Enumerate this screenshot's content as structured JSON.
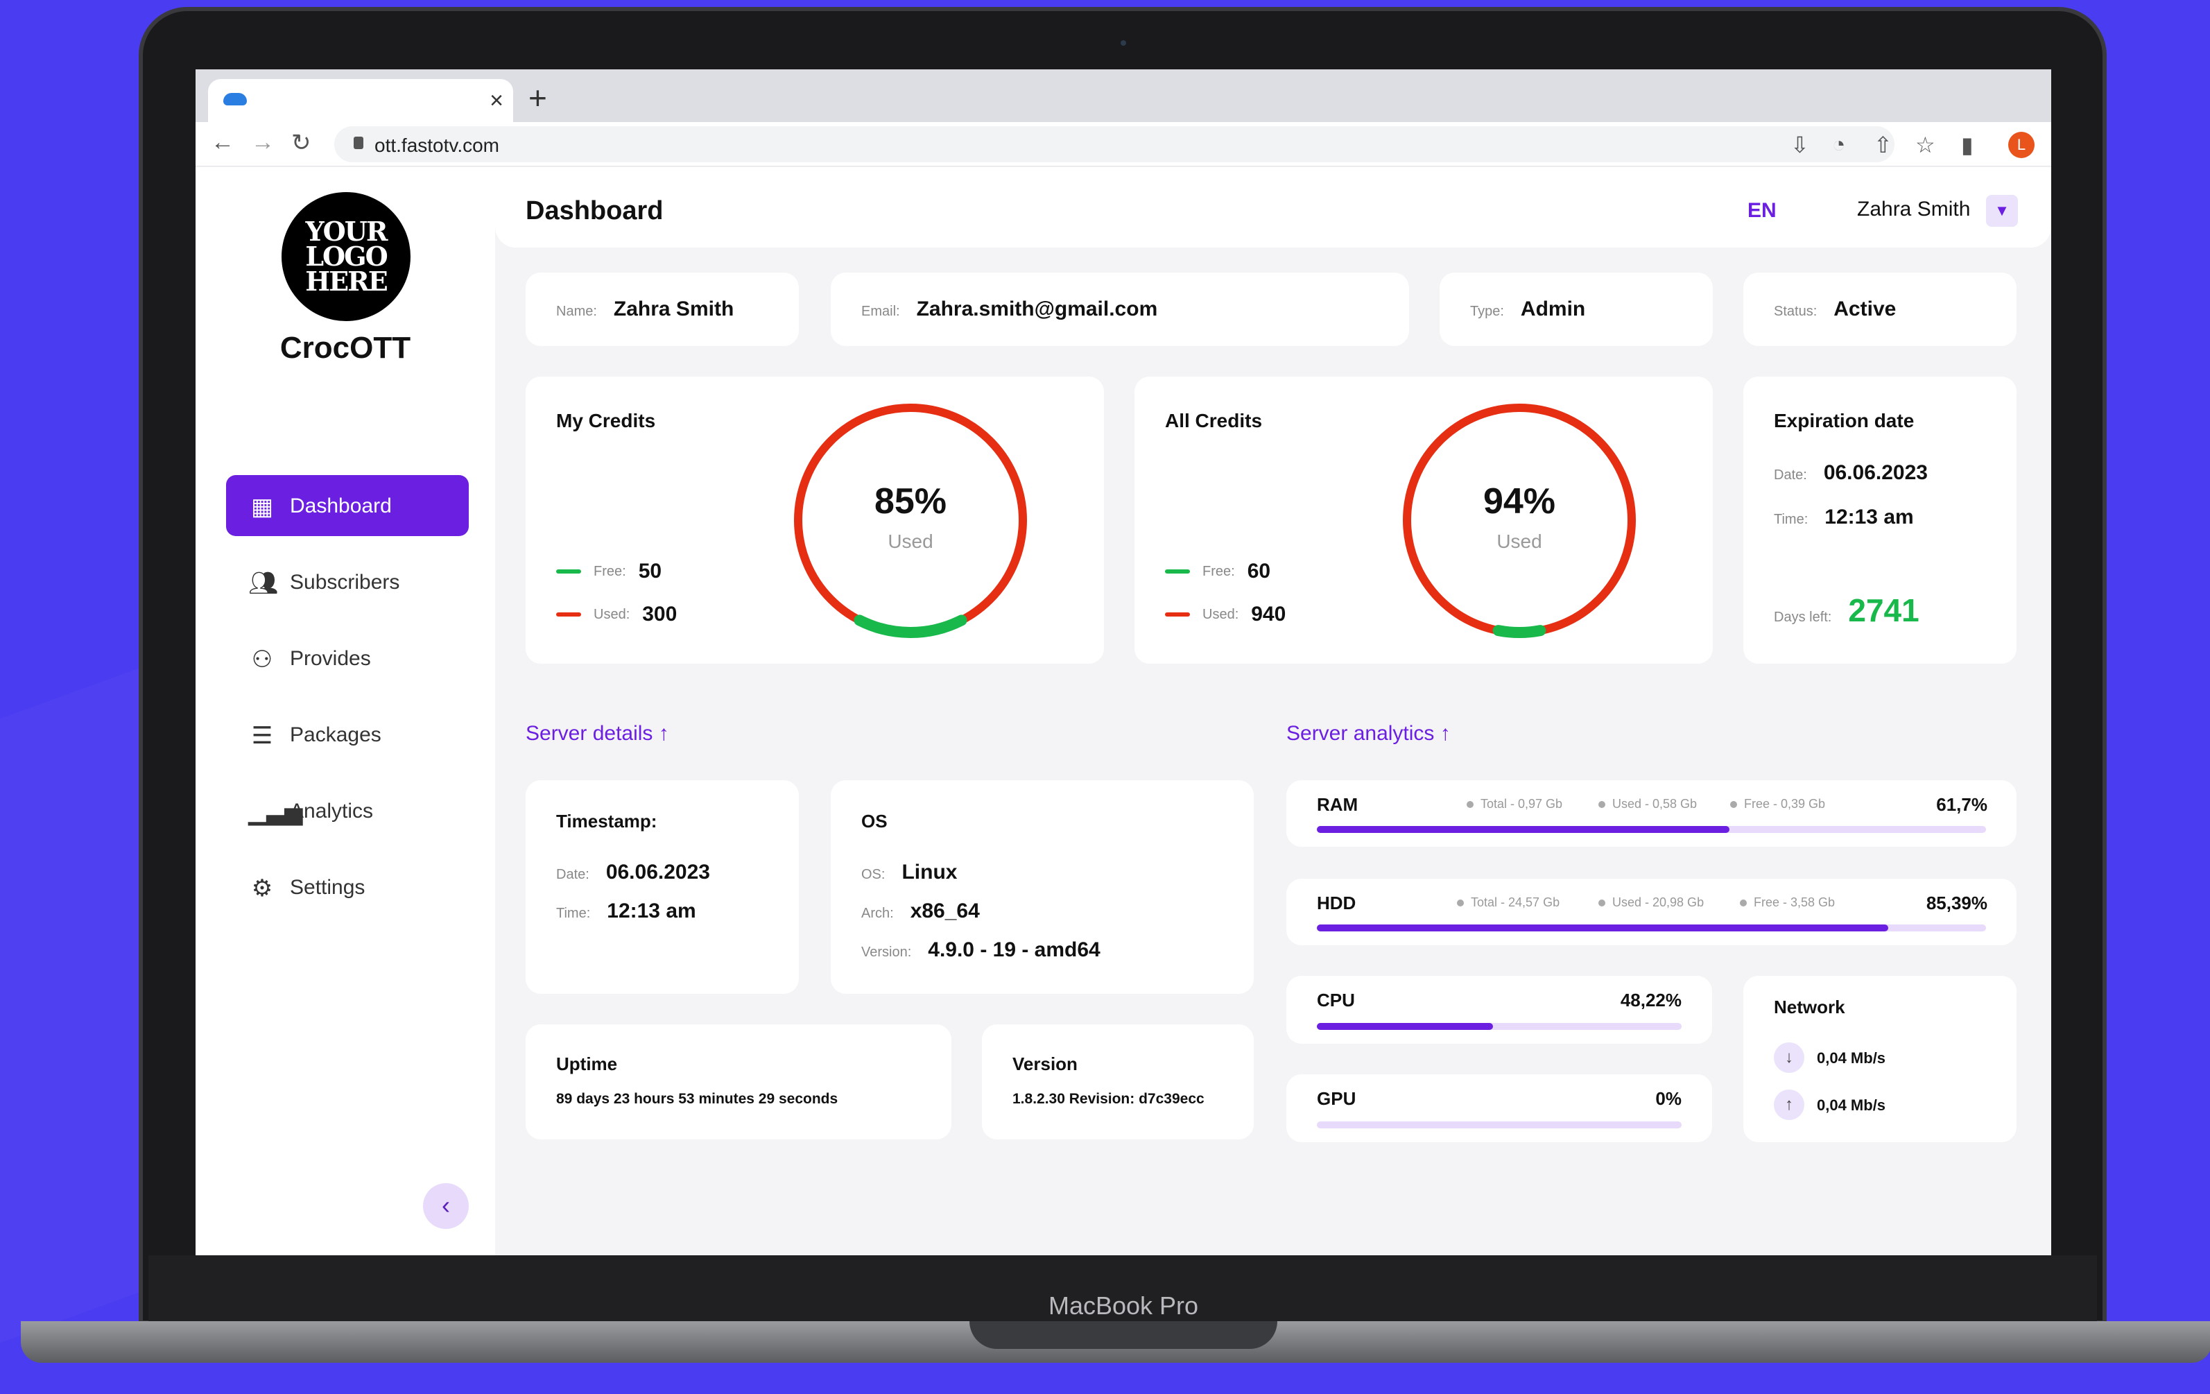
{
  "colors": {
    "accent": "#6b1fe0",
    "free": "#18b84a",
    "used": "#e62e12",
    "days_left": "#18b84a"
  },
  "device": {
    "label": "MacBook Pro"
  },
  "browser": {
    "url": "ott.fastotv.com",
    "new_tab": "+",
    "close_tab": "×",
    "avatar_initial": "L"
  },
  "sidebar": {
    "logo_text": "YOUR LOGO HERE",
    "app_name": "CrocOTT",
    "items": [
      {
        "label": "Dashboard",
        "icon": "grid-icon"
      },
      {
        "label": "Subscribers",
        "icon": "users-icon"
      },
      {
        "label": "Provides",
        "icon": "user-settings-icon"
      },
      {
        "label": "Packages",
        "icon": "package-icon"
      },
      {
        "label": "Analytics",
        "icon": "bar-chart-icon"
      },
      {
        "label": "Settings",
        "icon": "gear-icon"
      }
    ],
    "collapse": "‹"
  },
  "header": {
    "title": "Dashboard",
    "lang": "EN",
    "user": "Zahra Smith"
  },
  "profile": {
    "name_label": "Name:",
    "name": "Zahra Smith",
    "email_label": "Email:",
    "email": "Zahra.smith@gmail.com",
    "type_label": "Type:",
    "type": "Admin",
    "status_label": "Status:",
    "status": "Active"
  },
  "my_credits": {
    "title": "My Credits",
    "percent": "85%",
    "used_text": "Used",
    "used_fraction": 0.85,
    "free_label": "Free:",
    "free": "50",
    "used_label": "Used:",
    "used": "300"
  },
  "all_credits": {
    "title": "All Credits",
    "percent": "94%",
    "used_text": "Used",
    "used_fraction": 0.94,
    "free_label": "Free:",
    "free": "60",
    "used_label": "Used:",
    "used": "940"
  },
  "expiration": {
    "title": "Expiration date",
    "date_label": "Date:",
    "date": "06.06.2023",
    "time_label": "Time:",
    "time": "12:13 am",
    "days_label": "Days left:",
    "days": "2741"
  },
  "server_details": {
    "title": "Server details",
    "timestamp": {
      "title": "Timestamp:",
      "date_label": "Date:",
      "date": "06.06.2023",
      "time_label": "Time:",
      "time": "12:13 am"
    },
    "os": {
      "title": "OS",
      "os_label": "OS:",
      "os": "Linux",
      "arch_label": "Arch:",
      "arch": "x86_64",
      "version_label": "Version:",
      "version": "4.9.0 - 19 - amd64"
    },
    "uptime": {
      "title": "Uptime",
      "value": "89 days 23 hours 53 minutes 29 seconds"
    },
    "version": {
      "title": "Version",
      "value": "1.8.2.30 Revision: d7c39ecc"
    }
  },
  "server_analytics": {
    "title": "Server analytics",
    "ram": {
      "label": "RAM",
      "total": "Total - 0,97 Gb",
      "used": "Used - 0,58 Gb",
      "free": "Free - 0,39 Gb",
      "percent": "61,7%",
      "fraction": 0.617
    },
    "hdd": {
      "label": "HDD",
      "total": "Total - 24,57 Gb",
      "used": "Used - 20,98 Gb",
      "free": "Free - 3,58 Gb",
      "percent": "85,39%",
      "fraction": 0.8539
    },
    "cpu": {
      "label": "CPU",
      "percent": "48,22%",
      "fraction": 0.4822
    },
    "gpu": {
      "label": "GPU",
      "percent": "0%",
      "fraction": 0
    },
    "network": {
      "title": "Network",
      "down": "0,04 Mb/s",
      "up": "0,04 Mb/s"
    }
  }
}
